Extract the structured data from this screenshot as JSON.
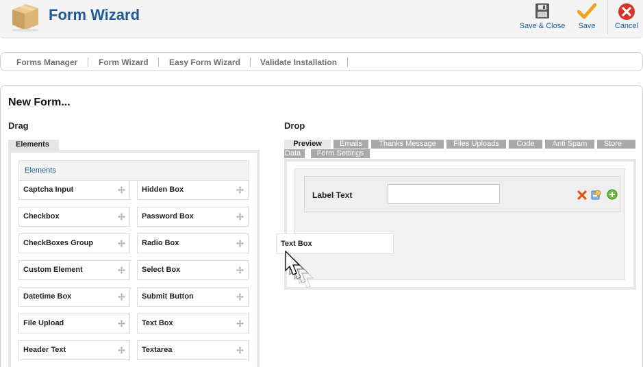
{
  "header": {
    "title": "Form Wizard",
    "logo_icon": "package-box-icon",
    "buttons": {
      "save_close": "Save & Close",
      "save": "Save",
      "cancel": "Cancel"
    }
  },
  "submenu": {
    "items": [
      {
        "label": "Forms Manager"
      },
      {
        "label": "Form Wizard"
      },
      {
        "label": "Easy Form Wizard"
      },
      {
        "label": "Validate Installation"
      }
    ]
  },
  "page": {
    "title": "New Form...",
    "drag_label": "Drag",
    "drop_label": "Drop"
  },
  "drag": {
    "tab": "Elements",
    "header": "Elements",
    "left_column": [
      "Captcha Input",
      "Checkbox",
      "CheckBoxes Group",
      "Custom Element",
      "Datetime Box",
      "File Upload",
      "Header Text"
    ],
    "right_column": [
      "Hidden Box",
      "Password Box",
      "Radio Box",
      "Select Box",
      "Submit Button",
      "Text Box",
      "Textarea"
    ]
  },
  "drop": {
    "tabs": [
      {
        "label": "Preview",
        "active": true
      },
      {
        "label": "Emails",
        "active": false
      },
      {
        "label": "Thanks Message",
        "active": false
      },
      {
        "label": "Files Uploads",
        "active": false
      },
      {
        "label": "Code",
        "active": false
      },
      {
        "label": "Anti Spam",
        "active": false
      },
      {
        "label": "Store",
        "active": false
      },
      {
        "label": "Data",
        "active": false
      },
      {
        "label": "Form Settings",
        "active": false
      }
    ],
    "field": {
      "label": "Label Text",
      "value": ""
    },
    "dragging_item": "Text Box"
  },
  "colors": {
    "title_blue": "#1e5b96",
    "cancel_red": "#d6332a",
    "save_orange": "#f3a21d",
    "tab_gray": "#a9a9a9"
  }
}
